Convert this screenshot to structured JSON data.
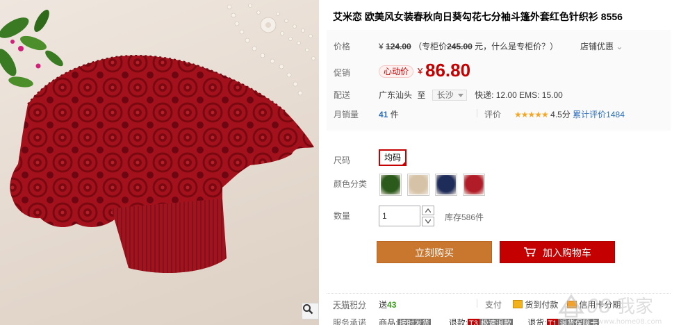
{
  "product": {
    "title": "艾米恋 欧美风女装春秋向日葵勾花七分袖斗篷外套红色针织衫 8556"
  },
  "price": {
    "label": "价格",
    "yen": "¥",
    "original": "124.00",
    "counter_open": "（专柜价",
    "counter_price": "245.00",
    "counter_unit": "元，",
    "counter_link": "什么是专柜价？",
    "counter_close": "）",
    "shop_promo": "店铺优惠"
  },
  "promo": {
    "label": "促销",
    "badge": "心动价",
    "yen": "¥",
    "price": "86.80"
  },
  "shipping": {
    "label": "配送",
    "from": "广东汕头",
    "to": "至",
    "city": "长沙",
    "fees": "快递: 12.00 EMS: 15.00"
  },
  "sales": {
    "label": "月销量",
    "count": "41",
    "unit": "件",
    "rating_label": "评价",
    "stars": "★★★★★",
    "score": "4.5分",
    "reviews": "累计评价1484"
  },
  "size": {
    "label": "尺码",
    "selected": "均码"
  },
  "color": {
    "label": "颜色分类",
    "swatches": [
      "#2c5a1c",
      "#d6c2a6",
      "#1e2c5a",
      "#b01c28"
    ]
  },
  "quantity": {
    "label": "数量",
    "value": "1",
    "stock": "库存586件"
  },
  "actions": {
    "buy_now": "立刻购买",
    "add_cart": "加入购物车"
  },
  "footer": {
    "points_label": "天猫积分",
    "points_prefix": "送",
    "points_value": "43",
    "pay_label": "支付",
    "pay_cod": "货到付款",
    "pay_card": "信用卡分期",
    "service_label": "服务承诺",
    "service_goods": "商品:",
    "service_goods_tag": "按时发货",
    "service_refund": "退款:",
    "service_refund_code": "T3",
    "service_refund_tag": "极速退款",
    "service_return": "退货:",
    "service_return_code": "T1",
    "service_return_tag": "退货保障卡"
  },
  "watermark": {
    "logo": "08",
    "text": "我家",
    "url": "www.home08.com"
  },
  "colors": {
    "accent": "#c40000",
    "buy": "#c9772f",
    "link": "#2c6dbd"
  }
}
